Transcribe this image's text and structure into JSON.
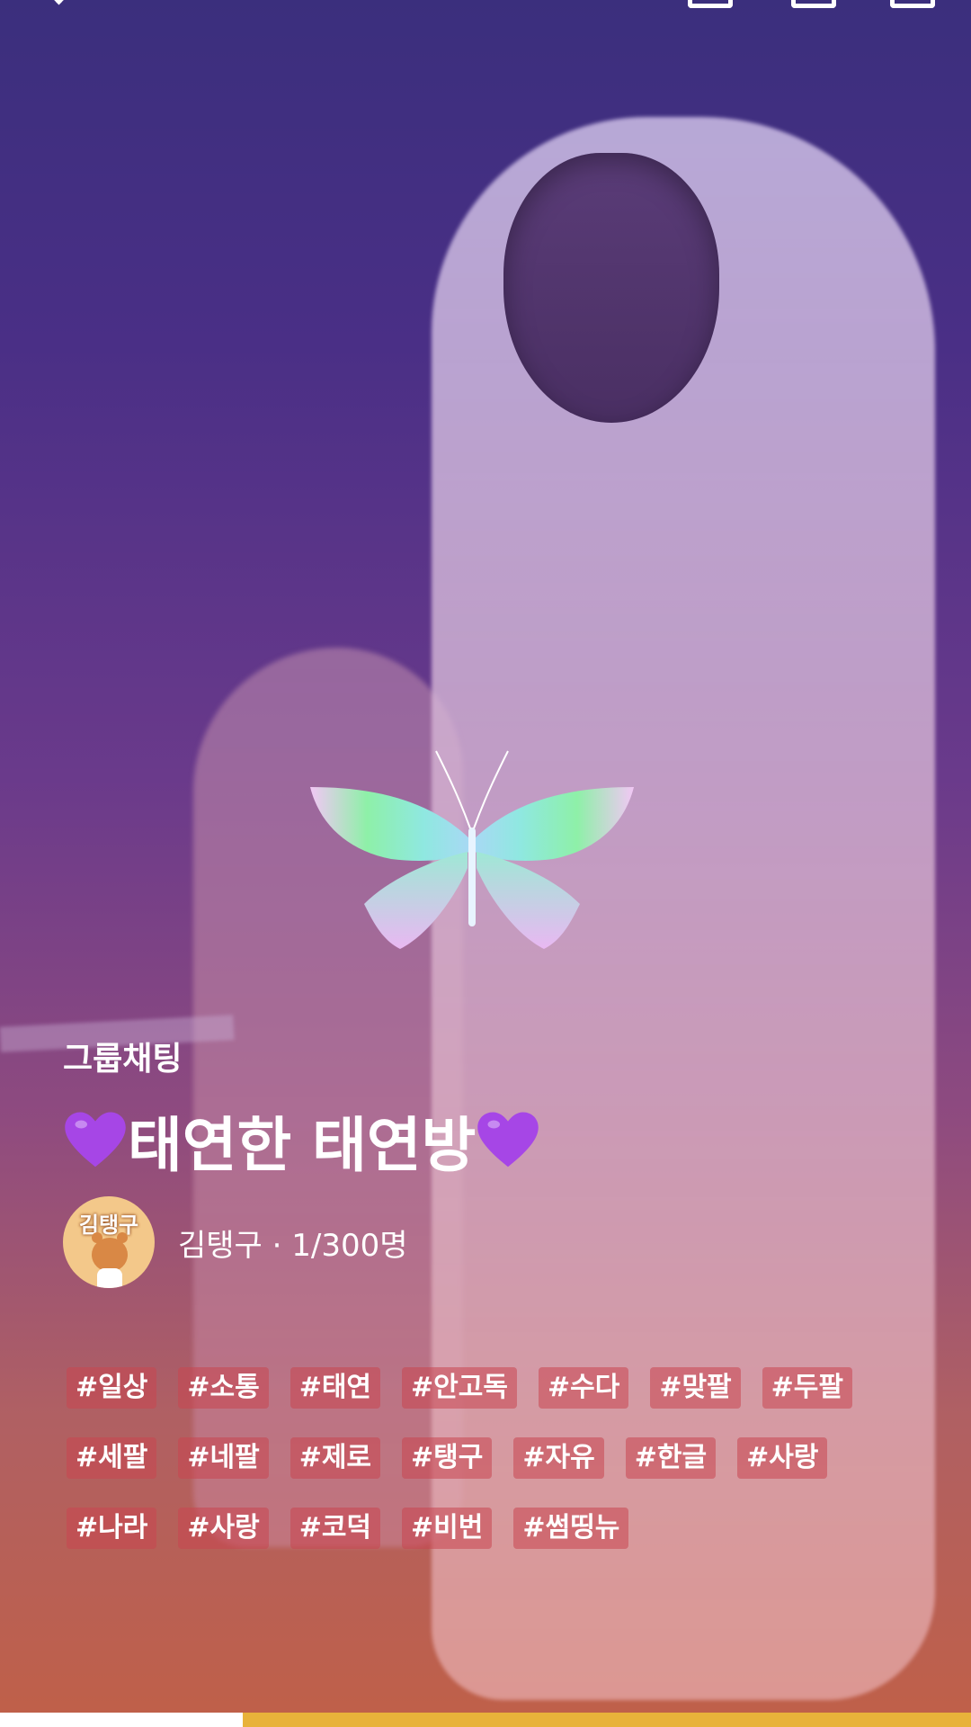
{
  "room": {
    "category": "그룹채팅",
    "title": "태연한 태연방",
    "owner_name": "김탱구",
    "member_count": "1/300명",
    "owner_line": "김탱구 · 1/300명",
    "avatar_label": "김탱구"
  },
  "tags": [
    [
      "#일상",
      "#소통",
      "#태연",
      "#안고독",
      "#수다",
      "#맞팔",
      "#두팔"
    ],
    [
      "#세팔",
      "#네팔",
      "#제로",
      "#탱구",
      "#자유",
      "#한글",
      "#사랑"
    ],
    [
      "#나라",
      "#사랑",
      "#코덕",
      "#비번",
      "#썸띵뉴"
    ]
  ],
  "icons": {
    "heart": "purple-heart-icon",
    "butterfly": "butterfly-sticker",
    "back": "chevron-left-icon"
  },
  "colors": {
    "accent_progress": "#e8b23a",
    "heart": "#a646e6",
    "tag_bg": "rgba(200,70,80,0.55)"
  },
  "progress": {
    "fraction": 0.25
  }
}
